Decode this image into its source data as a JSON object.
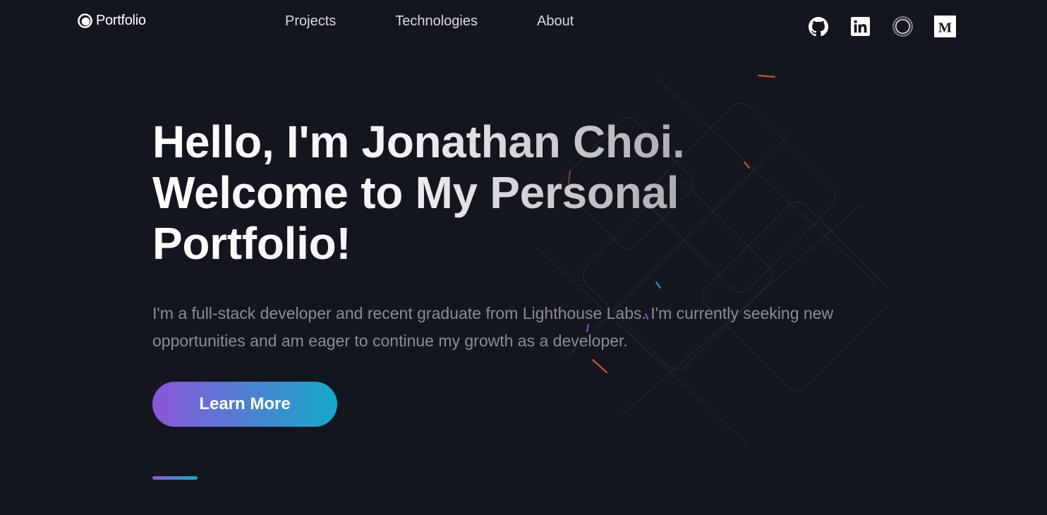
{
  "nav": {
    "brand": "Portfolio",
    "links": [
      "Projects",
      "Technologies",
      "About"
    ],
    "socials": [
      "github-icon",
      "linkedin-icon",
      "circle-ring-icon",
      "medium-icon"
    ]
  },
  "hero": {
    "title_line1": "Hello, I'm Jonathan Choi.",
    "title_line2": "Welcome to My Personal",
    "title_line3": "Portfolio!",
    "description": "I'm a full-stack developer and recent graduate from Lighthouse Labs. I'm currently seeking new opportunities and am eager to continue my growth as a developer.",
    "cta_label": "Learn More"
  },
  "colors": {
    "background": "#13161f",
    "gradient_start": "#8c56d6",
    "gradient_end": "#14a9c8"
  }
}
